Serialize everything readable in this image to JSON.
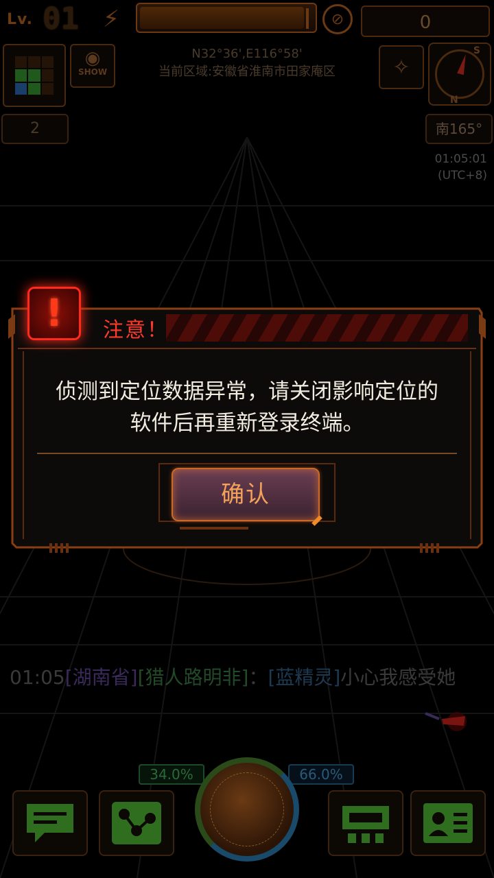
{
  "hud": {
    "level_label": "Lv.",
    "level_value": "01",
    "energy_fraction": 0.95,
    "score": "0",
    "show_label": "SHOW",
    "coordinates": "N32°36',E116°58'",
    "region": "当前区域:安徽省淮南市田家庵区",
    "count": "2",
    "heading": "南165°",
    "time": "01:05:01",
    "timezone": "(UTC+8)",
    "compass_s": "S",
    "compass_n": "N"
  },
  "dialog": {
    "title": "注意！",
    "alert_glyph": "!",
    "message_line1": "侦测到定位数据异常，请关闭影响定位的",
    "message_line2": "软件后再重新登录终端。",
    "confirm_label": "确认"
  },
  "chat": {
    "time": "01:05",
    "region": "[湖南省]",
    "user": "[猎人路明非]",
    "separator": "：",
    "mention": "[蓝精灵]",
    "text": "小心我感受她"
  },
  "bottom": {
    "left_pct": "34.0%",
    "right_pct": "66.0%"
  },
  "colors": {
    "accent_orange": "#c86a2a",
    "alert_red": "#ff2a1a",
    "hud_green": "#2a6a1a",
    "hud_blue": "#1a4a6a"
  }
}
